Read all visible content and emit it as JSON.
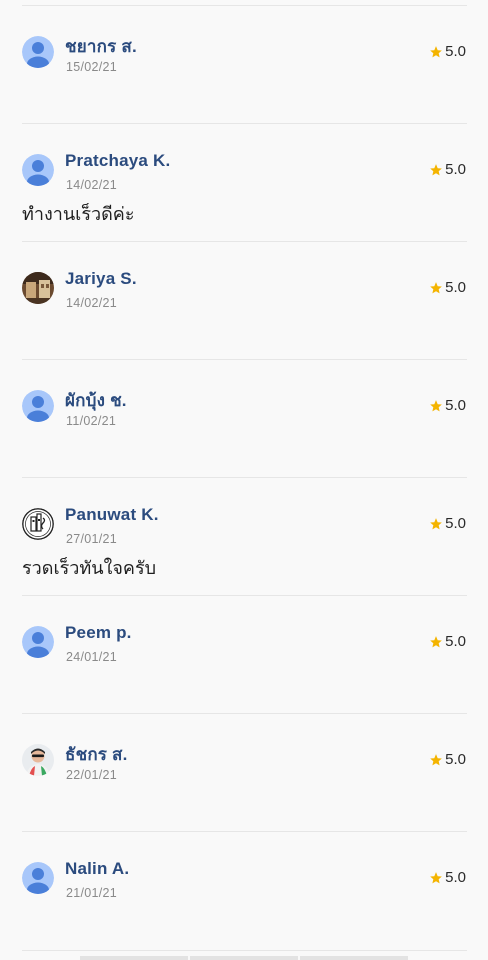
{
  "reviews": [
    {
      "name": "ชยากร ส.",
      "date": "15/02/21",
      "comment": "",
      "rating": "5.0",
      "avatar": "default-user-icon"
    },
    {
      "name": "Pratchaya K.",
      "date": "14/02/21",
      "comment": "ทำงานเร็วดีค่ะ",
      "rating": "5.0",
      "avatar": "default-user-icon"
    },
    {
      "name": "Jariya S.",
      "date": "14/02/21",
      "comment": "",
      "rating": "5.0",
      "avatar": "photo-avatar"
    },
    {
      "name": "ผักบุ้ง ช.",
      "date": "11/02/21",
      "comment": "",
      "rating": "5.0",
      "avatar": "default-user-icon"
    },
    {
      "name": "Panuwat K.",
      "date": "27/01/21",
      "comment": "รวดเร็วทันใจครับ",
      "rating": "5.0",
      "avatar": "logo-avatar"
    },
    {
      "name": "Peem p.",
      "date": "24/01/21",
      "comment": "",
      "rating": "5.0",
      "avatar": "default-user-icon"
    },
    {
      "name": "ธัชกร ส.",
      "date": "22/01/21",
      "comment": "",
      "rating": "5.0",
      "avatar": "photo-avatar"
    },
    {
      "name": "Nalin A.",
      "date": "21/01/21",
      "comment": "",
      "rating": "5.0",
      "avatar": "default-user-icon"
    }
  ],
  "colors": {
    "name": "#2b4b7e",
    "star": "#f4b400",
    "avatar_bg": "#a8c7fa",
    "avatar_fg": "#4a7fd9"
  }
}
